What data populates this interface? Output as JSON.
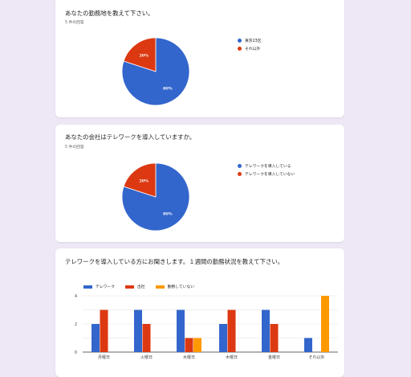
{
  "colors": {
    "blue": "#3366cc",
    "red": "#dc3912",
    "orange": "#ff9900",
    "grid": "#e0e0e0",
    "axis": "#333333"
  },
  "cards": [
    {
      "title": "あなたの勤務地を教えて下さい。",
      "response_count": "5 件の回答"
    },
    {
      "title": "あなたの会社はテレワークを導入していますか。",
      "response_count": "5 件の回答"
    },
    {
      "title": "テレワークを導入している方にお聞きします。１週間の勤務状況を教えて下さい。"
    }
  ],
  "chart_data": [
    {
      "type": "pie",
      "slices": [
        {
          "label": "東京23区",
          "value": 80,
          "data_label": "80%",
          "color": "#3366cc"
        },
        {
          "label": "それ以外",
          "value": 20,
          "data_label": "20%",
          "color": "#dc3912"
        }
      ],
      "legend_position": "right"
    },
    {
      "type": "pie",
      "slices": [
        {
          "label": "テレワークを導入している",
          "value": 80,
          "data_label": "80%",
          "color": "#3366cc"
        },
        {
          "label": "テレワークを導入していない",
          "value": 20,
          "data_label": "20%",
          "color": "#dc3912"
        }
      ],
      "legend_position": "right"
    },
    {
      "type": "bar",
      "categories": [
        "月曜日",
        "火曜日",
        "水曜日",
        "木曜日",
        "金曜日",
        "それ以外"
      ],
      "series": [
        {
          "name": "テレワーク",
          "color": "#3366cc",
          "values": [
            2,
            3,
            3,
            2,
            3,
            1
          ]
        },
        {
          "name": "出社",
          "color": "#dc3912",
          "values": [
            3,
            2,
            1,
            3,
            2,
            0
          ]
        },
        {
          "name": "勤務していない",
          "color": "#ff9900",
          "values": [
            0,
            0,
            1,
            0,
            0,
            4
          ]
        }
      ],
      "y_ticks": [
        "0",
        "2",
        "4"
      ],
      "ylim": [
        0,
        4
      ],
      "grid": true,
      "legend_position": "top-left"
    }
  ]
}
